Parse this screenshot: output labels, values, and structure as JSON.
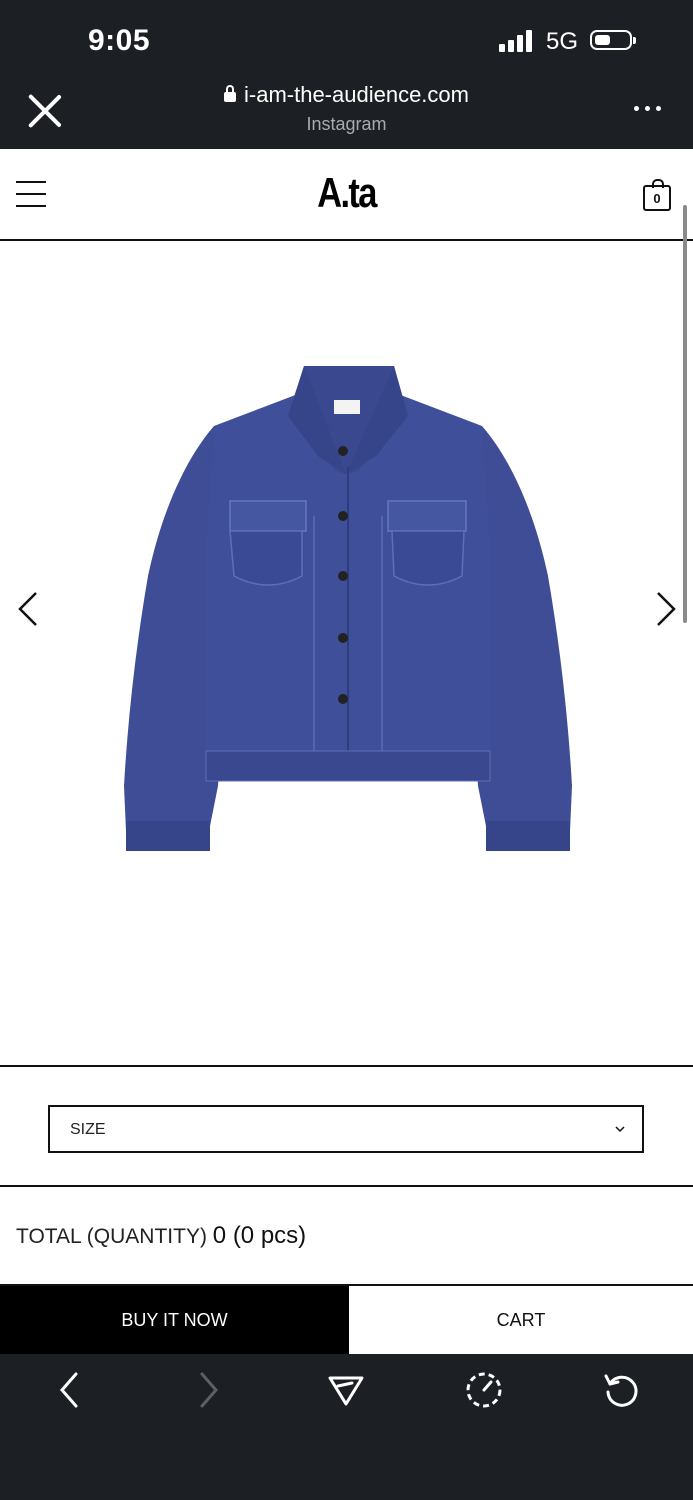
{
  "status_bar": {
    "time": "9:05",
    "network": "5G"
  },
  "browser": {
    "url": "i-am-the-audience.com",
    "source": "Instagram"
  },
  "site": {
    "logo": "A.ta",
    "cart_count": "0"
  },
  "product": {
    "image_alt": "navy denim trucker jacket",
    "size_label": "SIZE",
    "total_label": "TOTAL (QUANTITY)",
    "total_value": "0 (0 pcs)",
    "buy_label": "BUY IT NOW",
    "cart_label": "CART"
  },
  "colors": {
    "jacket": "#3f4f99",
    "dark_bar": "#1c1f24"
  },
  "icons": {
    "browser_close": "close-icon",
    "browser_more": "more-icon",
    "menu": "hamburger-icon",
    "cart": "bag-icon",
    "nav": [
      "back-icon",
      "forward-icon",
      "share-icon",
      "speed-icon",
      "reload-icon"
    ]
  }
}
